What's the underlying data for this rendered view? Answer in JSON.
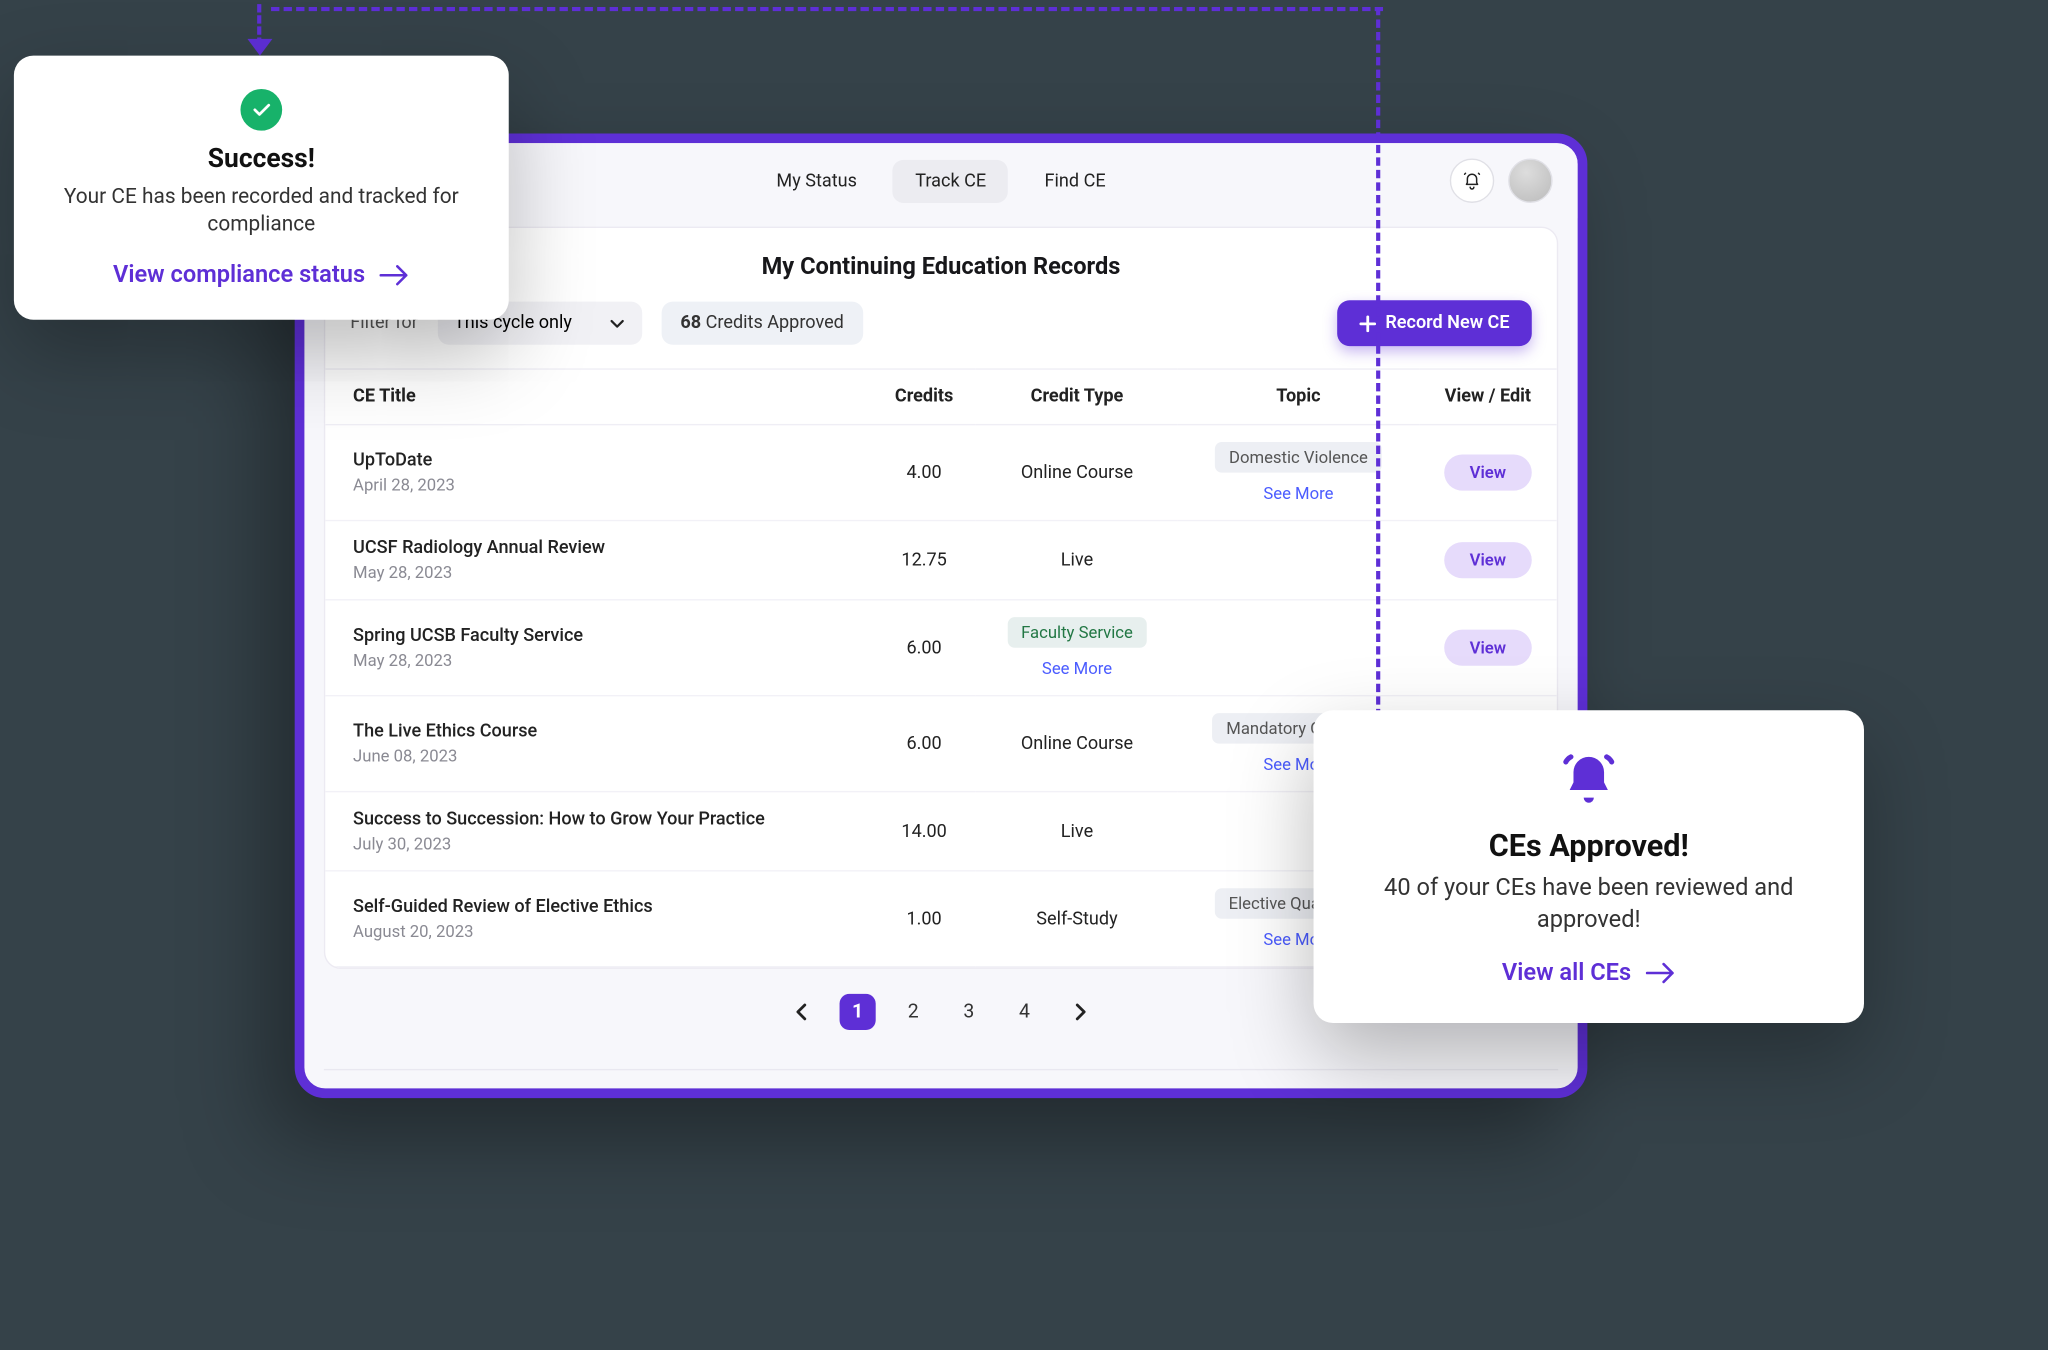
{
  "header": {
    "tabs": [
      "My Status",
      "Track CE",
      "Find CE"
    ],
    "active_tab": 1
  },
  "card": {
    "title": "My Continuing Education Records",
    "filter_label": "Filter for",
    "filter_value": "This cycle only",
    "credits_number": "68",
    "credits_text": "Credits Approved",
    "record_btn": "Record New CE",
    "columns": [
      "CE Title",
      "Credits",
      "Credit Type",
      "Topic",
      "View / Edit"
    ],
    "see_more": "See More",
    "view_label": "View",
    "rows": [
      {
        "title": "UpToDate",
        "date": "April 28, 2023",
        "credits": "4.00",
        "ctype_text": "Online Course",
        "ctype_tag": false,
        "ctype_see_more": false,
        "topic": "Domestic Violence",
        "topic_see_more": true,
        "view": true
      },
      {
        "title": "UCSF Radiology Annual Review",
        "date": "May 28, 2023",
        "credits": "12.75",
        "ctype_text": "Live",
        "ctype_tag": false,
        "ctype_see_more": false,
        "topic": "",
        "topic_see_more": false,
        "view": true
      },
      {
        "title": "Spring UCSB Faculty Service",
        "date": "May 28, 2023",
        "credits": "6.00",
        "ctype_text": "Faculty Service",
        "ctype_tag": true,
        "ctype_see_more": true,
        "topic": "",
        "topic_see_more": false,
        "view": true
      },
      {
        "title": "The Live Ethics Course",
        "date": "June 08, 2023",
        "credits": "6.00",
        "ctype_text": "Online Course",
        "ctype_tag": false,
        "ctype_see_more": false,
        "topic": "Mandatory Qualifi...",
        "topic_see_more": true,
        "view": true
      },
      {
        "title": "Success to Succession: How to Grow Your Practice",
        "date": "July 30, 2023",
        "credits": "14.00",
        "ctype_text": "Live",
        "ctype_tag": false,
        "ctype_see_more": false,
        "topic": "",
        "topic_see_more": false,
        "view": false
      },
      {
        "title": "Self-Guided Review of Elective Ethics",
        "date": "August 20, 2023",
        "credits": "1.00",
        "ctype_text": "Self-Study",
        "ctype_tag": false,
        "ctype_see_more": false,
        "topic": "Elective Qualifyin...",
        "topic_see_more": true,
        "view": false
      }
    ],
    "pages": [
      "1",
      "2",
      "3",
      "4"
    ],
    "active_page": 0
  },
  "pop_success": {
    "heading": "Success!",
    "body": "Your CE has been recorded and tracked for compliance",
    "link": "View compliance status"
  },
  "pop_approved": {
    "heading": "CEs Approved!",
    "body": "40 of your CEs have been reviewed and approved!",
    "link": "View all CEs"
  }
}
